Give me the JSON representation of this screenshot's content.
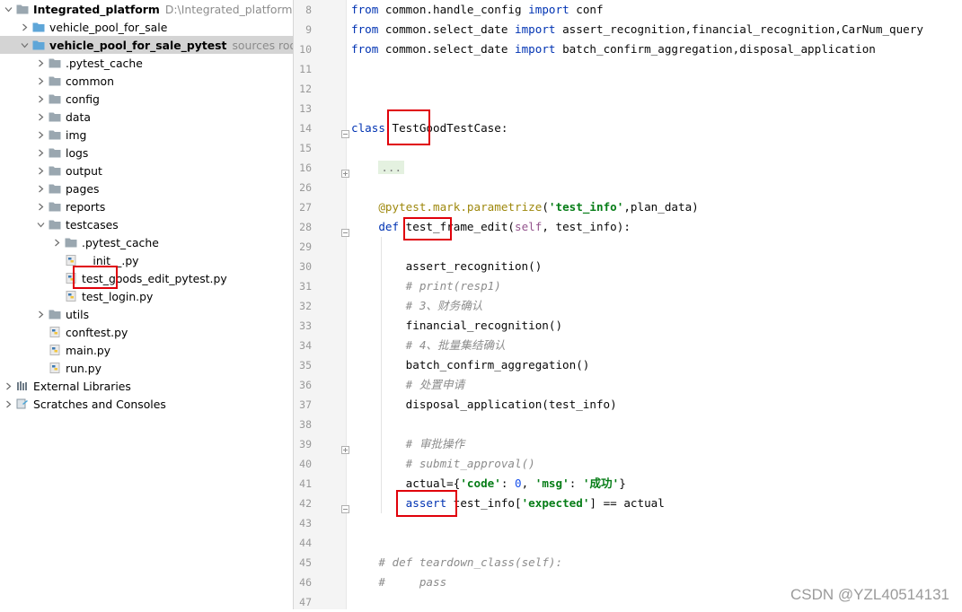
{
  "project": {
    "items": [
      {
        "label": "Integrated_platform",
        "hint": "D:\\Integrated_platform",
        "bold": true,
        "arrow": "down",
        "icon": "folder-icon"
      },
      {
        "label": "vehicle_pool_for_sale",
        "arrow": "right",
        "icon": "folder-icon"
      },
      {
        "label": "vehicle_pool_for_sale_pytest",
        "hint": "sources root",
        "bold": true,
        "arrow": "down",
        "icon": "folder-icon",
        "selected": true
      },
      {
        "label": ".pytest_cache",
        "arrow": "right",
        "icon": "folder-icon"
      },
      {
        "label": "common",
        "arrow": "right",
        "icon": "folder-icon"
      },
      {
        "label": "config",
        "arrow": "right",
        "icon": "folder-icon"
      },
      {
        "label": "data",
        "arrow": "right",
        "icon": "folder-icon"
      },
      {
        "label": "img",
        "arrow": "right",
        "icon": "folder-icon"
      },
      {
        "label": "logs",
        "arrow": "right",
        "icon": "folder-icon"
      },
      {
        "label": "output",
        "arrow": "right",
        "icon": "folder-icon"
      },
      {
        "label": "pages",
        "arrow": "right",
        "icon": "folder-icon"
      },
      {
        "label": "reports",
        "arrow": "right",
        "icon": "folder-icon"
      },
      {
        "label": "testcases",
        "arrow": "down",
        "icon": "folder-icon"
      },
      {
        "label": ".pytest_cache",
        "arrow": "right",
        "icon": "folder-icon"
      },
      {
        "label": "__init__.py",
        "icon": "python-file-icon"
      },
      {
        "label": "test_goods_edit_pytest.py",
        "icon": "python-file-icon"
      },
      {
        "label": "test_login.py",
        "icon": "python-file-icon"
      },
      {
        "label": "utils",
        "arrow": "right",
        "icon": "folder-icon"
      },
      {
        "label": "conftest.py",
        "icon": "python-file-icon"
      },
      {
        "label": "main.py",
        "icon": "python-file-icon"
      },
      {
        "label": "run.py",
        "icon": "python-file-icon"
      },
      {
        "label": "External Libraries",
        "arrow": "right",
        "icon": "libraries-icon"
      },
      {
        "label": "Scratches and Consoles",
        "arrow": "right",
        "icon": "scratches-icon"
      }
    ]
  },
  "editor": {
    "lines": [
      {
        "n": "8",
        "parts": [
          [
            "kw",
            "from"
          ],
          [
            "p",
            " common.handle_config "
          ],
          [
            "kw",
            "import"
          ],
          [
            "p",
            " conf"
          ]
        ]
      },
      {
        "n": "9",
        "parts": [
          [
            "kw",
            "from"
          ],
          [
            "p",
            " common.select_date "
          ],
          [
            "kw",
            "import"
          ],
          [
            "p",
            " assert_recognition,financial_recognition,CarNum_query"
          ]
        ]
      },
      {
        "n": "10",
        "parts": [
          [
            "kw",
            "from"
          ],
          [
            "p",
            " common.select_date "
          ],
          [
            "kw",
            "import"
          ],
          [
            "p",
            " batch_confirm_aggregation,disposal_application"
          ]
        ]
      },
      {
        "n": "11",
        "parts": []
      },
      {
        "n": "12",
        "parts": []
      },
      {
        "n": "13",
        "parts": []
      },
      {
        "n": "14",
        "parts": [
          [
            "kw",
            "class"
          ],
          [
            "p",
            " TestGoodTestCase:"
          ]
        ]
      },
      {
        "n": "15",
        "parts": []
      },
      {
        "n": "16",
        "parts": [
          [
            "p",
            "    "
          ],
          [
            "ellip",
            "..."
          ]
        ]
      },
      {
        "n": "26",
        "parts": []
      },
      {
        "n": "27",
        "parts": [
          [
            "p",
            "    "
          ],
          [
            "dec",
            "@pytest.mark.parametrize"
          ],
          [
            "p",
            "("
          ],
          [
            "str",
            "'test_info'"
          ],
          [
            "p",
            ",plan_data)"
          ]
        ]
      },
      {
        "n": "28",
        "parts": [
          [
            "p",
            "    "
          ],
          [
            "kw",
            "def"
          ],
          [
            "p",
            " test_frame_edit("
          ],
          [
            "self",
            "self"
          ],
          [
            "p",
            ", test_info):"
          ]
        ]
      },
      {
        "n": "29",
        "parts": []
      },
      {
        "n": "30",
        "parts": [
          [
            "p",
            "        assert_recognition()"
          ]
        ]
      },
      {
        "n": "31",
        "parts": [
          [
            "p",
            "        "
          ],
          [
            "cmt",
            "# print(resp1)"
          ]
        ]
      },
      {
        "n": "32",
        "parts": [
          [
            "p",
            "        "
          ],
          [
            "cmt",
            "# 3、财务确认"
          ]
        ]
      },
      {
        "n": "33",
        "parts": [
          [
            "p",
            "        financial_recognition()"
          ]
        ]
      },
      {
        "n": "34",
        "parts": [
          [
            "p",
            "        "
          ],
          [
            "cmt",
            "# 4、批量集结确认"
          ]
        ]
      },
      {
        "n": "35",
        "parts": [
          [
            "p",
            "        batch_confirm_aggregation()"
          ]
        ]
      },
      {
        "n": "36",
        "parts": [
          [
            "p",
            "        "
          ],
          [
            "cmt",
            "# 处置申请"
          ]
        ]
      },
      {
        "n": "37",
        "parts": [
          [
            "p",
            "        disposal_application(test_info)"
          ]
        ]
      },
      {
        "n": "38",
        "parts": []
      },
      {
        "n": "39",
        "parts": [
          [
            "p",
            "        "
          ],
          [
            "cmt",
            "# 审批操作"
          ]
        ]
      },
      {
        "n": "40",
        "parts": [
          [
            "p",
            "        "
          ],
          [
            "cmt",
            "# submit_approval()"
          ]
        ]
      },
      {
        "n": "41",
        "parts": [
          [
            "p",
            "        actual={"
          ],
          [
            "str",
            "'code'"
          ],
          [
            "p",
            ": "
          ],
          [
            "num",
            "0"
          ],
          [
            "p",
            ", "
          ],
          [
            "str",
            "'msg'"
          ],
          [
            "p",
            ": "
          ],
          [
            "str",
            "'成功'"
          ],
          [
            "p",
            "}"
          ]
        ]
      },
      {
        "n": "42",
        "parts": [
          [
            "p",
            "        "
          ],
          [
            "kw",
            "assert"
          ],
          [
            "p",
            " test_info["
          ],
          [
            "str",
            "'expected'"
          ],
          [
            "p",
            "] == actual"
          ]
        ]
      },
      {
        "n": "43",
        "parts": []
      },
      {
        "n": "44",
        "parts": []
      },
      {
        "n": "45",
        "parts": [
          [
            "p",
            "    "
          ],
          [
            "cmt",
            "# def teardown_class(self):"
          ]
        ]
      },
      {
        "n": "46",
        "parts": [
          [
            "p",
            "    "
          ],
          [
            "cmt",
            "#     pass"
          ]
        ]
      },
      {
        "n": "47",
        "parts": []
      }
    ]
  },
  "watermark": "CSDN @YZL40514131",
  "colors": {
    "highlight_box": "#e0000a",
    "keyword": "#0033b3",
    "string": "#067d17",
    "comment": "#8c8c8c",
    "decorator": "#9e880d",
    "selection": "#d4d4d4"
  }
}
